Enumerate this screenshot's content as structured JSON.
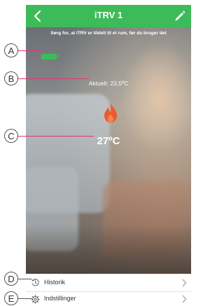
{
  "header": {
    "title": "iTRV 1",
    "back_icon": "chevron-left-icon",
    "edit_icon": "pencil-icon",
    "color": "#3dbb58"
  },
  "main": {
    "notice": "Sørg for, at iTRV er tildelt til et rum, før du bruger det",
    "battery_icon": "battery-icon",
    "current_temp": "Aktuelt: 23,5ºC",
    "flame_icon": "flame-icon",
    "flame_color": "#ee5a2b",
    "setpoint": "27ºC"
  },
  "menu": {
    "history": {
      "label": "Historik",
      "icon": "history-icon"
    },
    "settings": {
      "label": "Indstillinger",
      "icon": "gear-icon"
    }
  },
  "callouts": {
    "a": "A",
    "b": "B",
    "c": "C",
    "d": "D",
    "e": "E"
  }
}
